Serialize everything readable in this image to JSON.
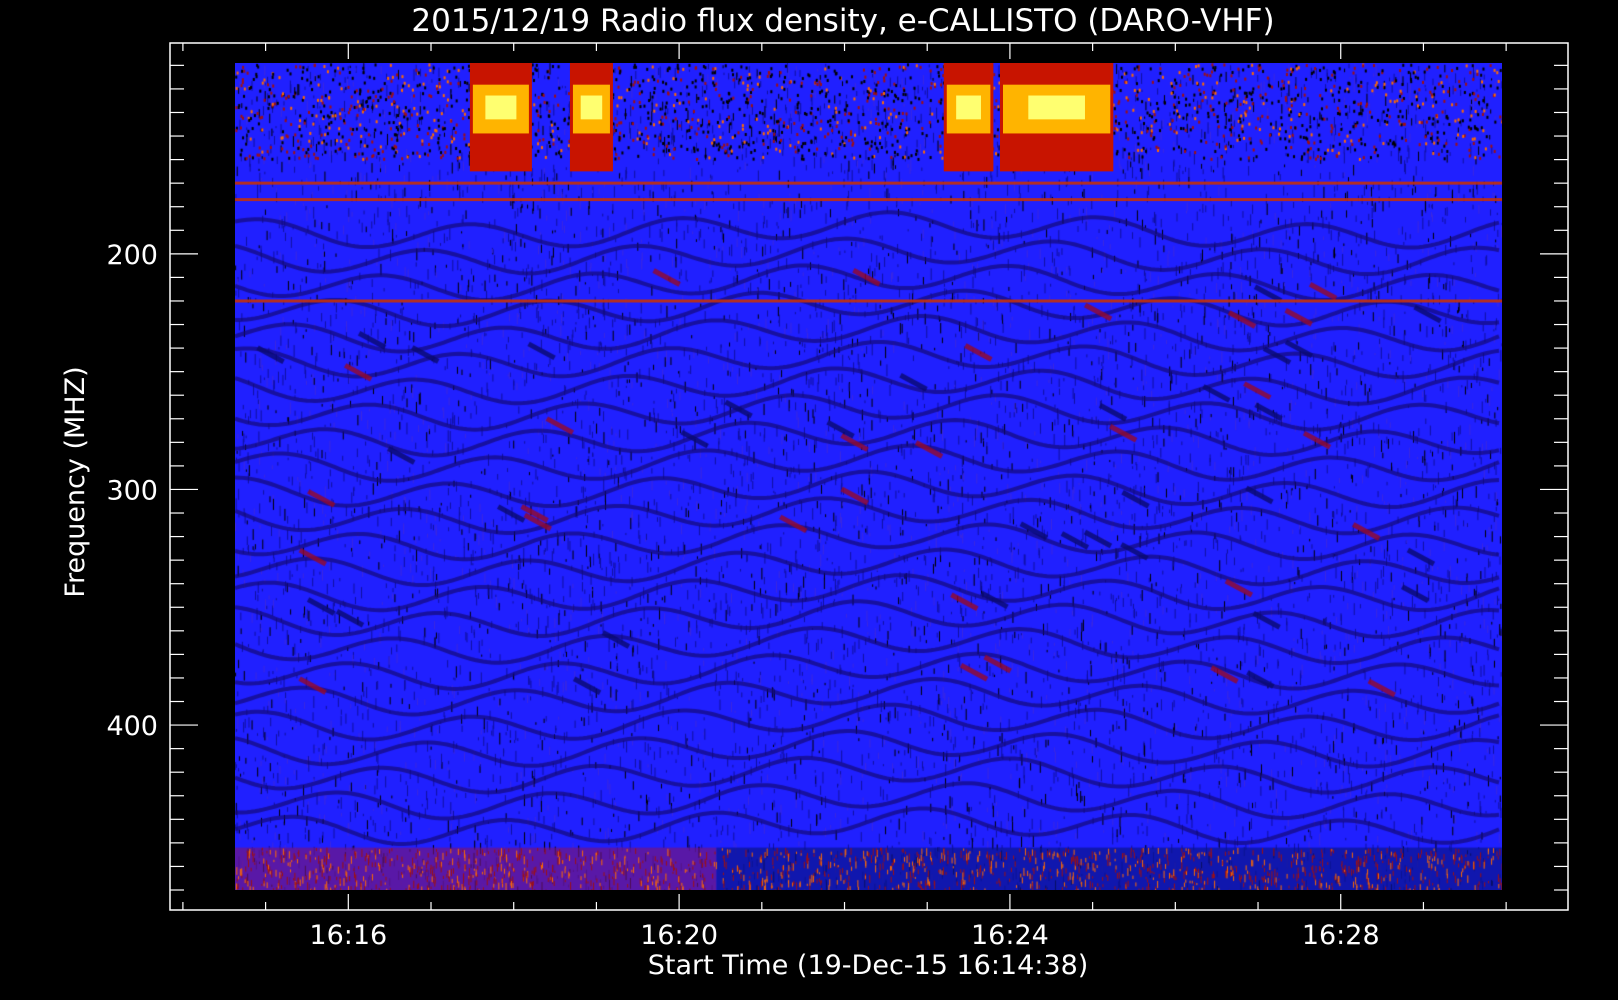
{
  "chart_data": {
    "type": "heatmap",
    "title": "2015/12/19  Radio flux density, e-CALLISTO (DARO-VHF)",
    "xlabel": "Start Time (19-Dec-15 16:14:38)",
    "ylabel": "Frequency (MHZ)",
    "x_unit": "minutes",
    "xlim": [
      14.0,
      31.0
    ],
    "x_data_range": [
      14.63,
      29.95
    ],
    "x_ticks": [
      {
        "value": 16,
        "label": "16:16"
      },
      {
        "value": 20,
        "label": "16:20"
      },
      {
        "value": 24,
        "label": "16:24"
      },
      {
        "value": 28,
        "label": "16:28"
      }
    ],
    "ylim": [
      110,
      480
    ],
    "y_inverted": true,
    "y_data_range": [
      119,
      470
    ],
    "y_ticks": [
      {
        "value": 200,
        "label": "200"
      },
      {
        "value": 300,
        "label": "300"
      },
      {
        "value": 400,
        "label": "400"
      }
    ],
    "colormap": [
      "#000000",
      "#1010a0",
      "#2020ff",
      "#3c28e0",
      "#7a0a5a",
      "#a01010",
      "#d02000",
      "#ff6a00",
      "#ffc000",
      "#ffff60"
    ],
    "background_color": "#2020ff",
    "bursts": [
      {
        "t_start": 17.47,
        "t_end": 18.22,
        "f_low": 119,
        "f_high": 165,
        "intensity": 0.9
      },
      {
        "t_start": 18.68,
        "t_end": 19.2,
        "f_low": 119,
        "f_high": 165,
        "intensity": 0.9
      },
      {
        "t_start": 23.2,
        "t_end": 23.8,
        "f_low": 119,
        "f_high": 165,
        "intensity": 0.9
      },
      {
        "t_start": 23.88,
        "t_end": 25.25,
        "f_low": 119,
        "f_high": 165,
        "intensity": 0.95
      }
    ],
    "interference_lines_mhz": [
      170,
      177,
      220
    ]
  }
}
